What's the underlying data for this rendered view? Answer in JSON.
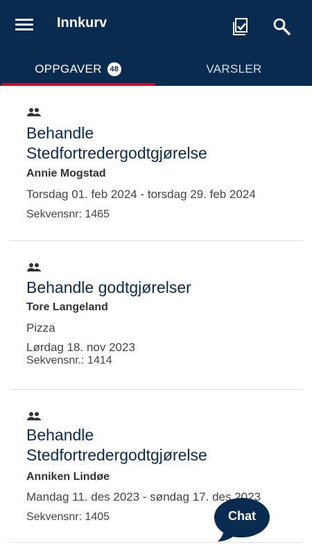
{
  "header": {
    "title": "Innkurv",
    "menu_icon": "hamburger-menu-icon",
    "tasks_icon": "checklist-icon",
    "search_icon": "search-icon"
  },
  "tabs": [
    {
      "label": "OPPGAVER",
      "badge": "48",
      "active": true
    },
    {
      "label": "VARSLER",
      "active": false
    }
  ],
  "items": [
    {
      "icon": "people-icon",
      "title_line1": "Behandle",
      "title_line2": "Stedfortredergodtgjørelse",
      "name": "Annie Mogstad",
      "period": "Torsdag 01. feb 2024 - torsdag 29. feb 2024",
      "sequence": "Sekvensnr: 1465"
    },
    {
      "icon": "people-icon",
      "title": "Behandle godtgjørelser",
      "name": "Tore Langeland",
      "description": "Pizza",
      "date": "Lørdag 18. nov 2023",
      "sequence": "Sekvensnr.: 1414"
    },
    {
      "icon": "people-icon",
      "title_line1": "Behandle",
      "title_line2": "Stedfortredergodtgjørelse",
      "name": "Anniken Lindøe",
      "period": "Mandag 11. des 2023 - søndag 17. des 2023",
      "sequence": "Sekvensnr: 1405"
    }
  ],
  "chat": {
    "label": "Chat"
  },
  "colors": {
    "primary": "#0a2b50",
    "accent": "#c8102e"
  }
}
